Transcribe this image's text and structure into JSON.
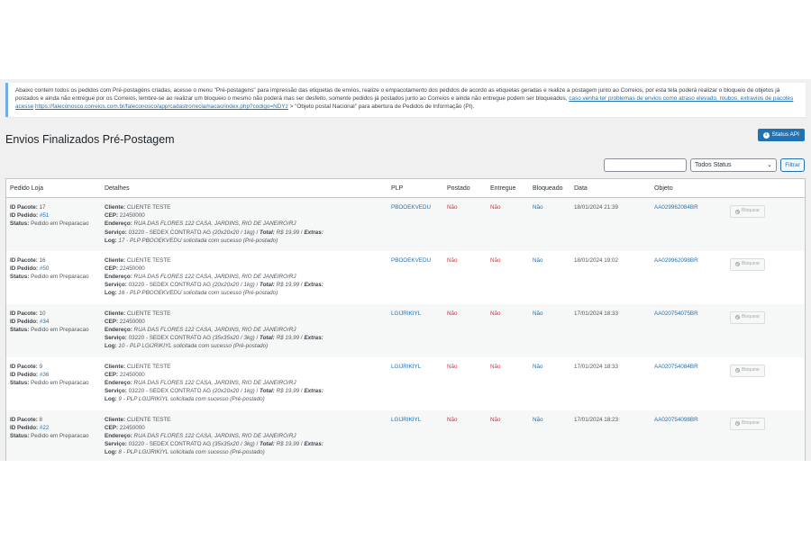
{
  "notice": {
    "text1": "Abaixo contem todos os pedidos com Pré-postagens criadas, acesse o menu \"Pré-postagens\" para impressão das etiquetas de envios, realize o empacotamento dos pedidos de acordo as etiquetas geradas e realize a postagem junto ao Correios, por esta tela poderá realizar o bloqueio de objetos já postados e ainda não entregue por os Correios, lembre-se ao realizar um bloqueio o mesmo não poderá mas ser desfeito, somente pedidos já postados junto ao Correios e ainda não entregue podem ser bloqueados, ",
    "link1": "caso venha ter problemas de envios como atraso elevado, roubos, extravios de pacotes acesse",
    "link2": "https://faleconosco.correios.com.br/faleconosco/app/cadastro/reclamacao/index.php?codigo=NDYz",
    "text2": " > \"Objeto postal Nacional\" para abertura de Pedidos de Informação (PI)."
  },
  "page": {
    "title": "Envios Finalizados Pré-Postagem"
  },
  "toolbar": {
    "status_api_label": "Status API",
    "search_value": "",
    "status_select": "Todos Status",
    "filter_label": "Filtrar"
  },
  "table": {
    "headers": [
      "Pedido Loja",
      "Detalhes",
      "PLP",
      "Postado",
      "Entregue",
      "Bloqueado",
      "Data",
      "Objeto",
      ""
    ],
    "labels": {
      "id_pacote": "ID Pacote:",
      "id_pedido": "ID Pedido:",
      "status": "Status:",
      "cliente": "Cliente:",
      "cep": "CEP:",
      "endereco": "Endereço:",
      "servico": "Serviço:",
      "total": "Total:",
      "extras": "Extras:",
      "log": "Log:",
      "block_btn": "Bloquear"
    },
    "rows": [
      {
        "id_pacote": "17",
        "id_pedido": "#51",
        "status": "Pedido em Preparacao",
        "cliente": "CLIENTE TESTE",
        "cep": "22450000",
        "endereco": "RUA DAS FLORES 122 CASA, JARDINS, RIO DE JANEIRO/RJ",
        "servico": "03220 - SEDEX CONTRATO AG",
        "dims": "(20x20x20 / 1kg)",
        "total": "R$ 19,99",
        "log": "17 - PLP PBOOEKVEDU solicitada com sucesso (Pré-postado)",
        "plp": "PBOOEKVEDU",
        "postado": "Não",
        "entregue": "Não",
        "bloqueado": "Não",
        "data": "18/01/2024 21:39",
        "objeto": "AA029962084BR"
      },
      {
        "id_pacote": "16",
        "id_pedido": "#50",
        "status": "Pedido em Preparacao",
        "cliente": "CLIENTE TESTE",
        "cep": "22450000",
        "endereco": "RUA DAS FLORES 122 CASA, JARDINS, RIO DE JANEIRO/RJ",
        "servico": "03220 - SEDEX CONTRATO AG",
        "dims": "(20x20x20 / 1kg)",
        "total": "R$ 19,99",
        "log": "16 - PLP PBOOEKVEDU solicitada com sucesso (Pré-postado)",
        "plp": "PBOOEKVEDU",
        "postado": "Não",
        "entregue": "Não",
        "bloqueado": "Não",
        "data": "18/01/2024 19:02",
        "objeto": "AA029962098BR"
      },
      {
        "id_pacote": "10",
        "id_pedido": "#34",
        "status": "Pedido em Preparacao",
        "cliente": "CLIENTE TESTE",
        "cep": "22450000",
        "endereco": "RUA DAS FLORES 122 CASA, JARDINS, RIO DE JANEIRO/RJ",
        "servico": "03220 - SEDEX CONTRATO AG",
        "dims": "(35x35x20 / 3kg)",
        "total": "R$ 19,99",
        "log": "10 - PLP LGIJRIKIYL solicitada com sucesso (Pré-postado)",
        "plp": "LGIJRIKIYL",
        "postado": "Não",
        "entregue": "Não",
        "bloqueado": "Não",
        "data": "17/01/2024 18:33",
        "objeto": "AA020754075BR"
      },
      {
        "id_pacote": "9",
        "id_pedido": "#36",
        "status": "Pedido em Preparacao",
        "cliente": "CLIENTE TESTE",
        "cep": "22450000",
        "endereco": "RUA DAS FLORES 122 CASA, JARDINS, RIO DE JANEIRO/RJ",
        "servico": "03220 - SEDEX CONTRATO AG",
        "dims": "(20x20x20 / 1kg)",
        "total": "R$ 19,99",
        "log": "9 - PLP LGIJRIKIYL solicitada com sucesso (Pré-postado)",
        "plp": "LGIJRIKIYL",
        "postado": "Não",
        "entregue": "Não",
        "bloqueado": "Não",
        "data": "17/01/2024 18:33",
        "objeto": "AA020754084BR"
      },
      {
        "id_pacote": "8",
        "id_pedido": "#22",
        "status": "Pedido em Preparacao",
        "cliente": "CLIENTE TESTE",
        "cep": "22450000",
        "endereco": "RUA DAS FLORES 122 CASA, JARDINS, RIO DE JANEIRO/RJ",
        "servico": "03220 - SEDEX CONTRATO AG",
        "dims": "(35x35x20 / 3kg)",
        "total": "R$ 19,99",
        "log": "8 - PLP LGIJRIKIYL solicitada com sucesso (Pré-postado)",
        "plp": "LGIJRIKIYL",
        "postado": "Não",
        "entregue": "Não",
        "bloqueado": "Não",
        "data": "17/01/2024 18:23",
        "objeto": "AA020754098BR"
      }
    ]
  }
}
